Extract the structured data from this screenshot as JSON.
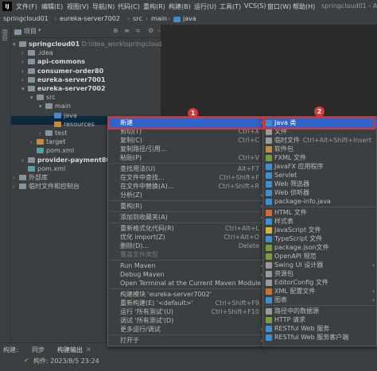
{
  "menubar": {
    "logo": "IJ",
    "items": [
      "文件(F)",
      "编辑(E)",
      "视图(V)",
      "导航(N)",
      "代码(C)",
      "重构(R)",
      "构建(B)",
      "运行(U)",
      "工具(T)",
      "VCS(S)",
      "窗口(W)",
      "帮助(H)"
    ],
    "title": "springcloud01 - Admi"
  },
  "navbar": [
    "springcloud01",
    "eureka-server7002",
    "src",
    "main",
    "java"
  ],
  "stripe": {
    "label": "项目"
  },
  "project_header": {
    "label": "项目"
  },
  "tree": [
    {
      "label": "springcloud01",
      "suffix": " D:\\idea_work\\springcloud01",
      "indent": 0,
      "bold": true,
      "icon": "folder-icon"
    },
    {
      "label": ".idea",
      "indent": 1,
      "icon": "folder-icon"
    },
    {
      "label": "api-commons",
      "indent": 1,
      "bold": true,
      "icon": "folder-icon"
    },
    {
      "label": "consumer-order80",
      "indent": 1,
      "bold": true,
      "icon": "folder-icon"
    },
    {
      "label": "eureka-server7001",
      "indent": 1,
      "bold": true,
      "icon": "folder-icon"
    },
    {
      "label": "eureka-server7002",
      "indent": 1,
      "bold": true,
      "icon": "folder-icon"
    },
    {
      "label": "src",
      "indent": 2,
      "icon": "folder-icon"
    },
    {
      "label": "main",
      "indent": 3,
      "icon": "folder-icon"
    },
    {
      "label": "java",
      "indent": 4,
      "icon": "folder-icon"
    },
    {
      "label": "resources",
      "indent": 4,
      "icon": "folder-icon"
    },
    {
      "label": "test",
      "indent": 3,
      "icon": "folder-icon"
    },
    {
      "label": "target",
      "indent": 2,
      "icon": "folder-icon"
    },
    {
      "label": "pom.xml",
      "indent": 2,
      "icon": "file-icon"
    },
    {
      "label": "provider-payment8001",
      "indent": 1,
      "bold": true,
      "icon": "folder-icon"
    },
    {
      "label": "pom.xml",
      "indent": 1,
      "icon": "file-icon"
    },
    {
      "label": "外部库",
      "indent": 0,
      "icon": "library-icon"
    },
    {
      "label": "临时文件和控制台",
      "indent": 0,
      "icon": "scratch-icon"
    }
  ],
  "bottom": {
    "tabs": [
      "构建:",
      "同步",
      "构建输出"
    ],
    "status": "构件: 2023/8/5 23:24"
  },
  "context_menu": [
    {
      "label": "新建",
      "shortcut": "",
      "submenu": true,
      "highlight": true
    },
    {
      "label": "剪切(T)",
      "shortcut": "Ctrl+X"
    },
    {
      "label": "复制(C)",
      "shortcut": "Ctrl+C"
    },
    {
      "label": "复制路径/引用...",
      "shortcut": ""
    },
    {
      "label": "粘贴(P)",
      "shortcut": "Ctrl+V"
    },
    {
      "sep": true
    },
    {
      "label": "查找用法(U)",
      "shortcut": "Alt+F7"
    },
    {
      "label": "在文件中查找...",
      "shortcut": "Ctrl+Shift+F"
    },
    {
      "label": "在文件中替换(A)...",
      "shortcut": "Ctrl+Shift+R"
    },
    {
      "label": "分析(Z)",
      "shortcut": "",
      "submenu": true
    },
    {
      "sep": true
    },
    {
      "label": "重构(R)",
      "shortcut": "",
      "submenu": true
    },
    {
      "sep": true
    },
    {
      "label": "添加到收藏夹(A)",
      "shortcut": "",
      "submenu": true
    },
    {
      "sep": true
    },
    {
      "label": "重新格式化代码(R)",
      "shortcut": "Ctrl+Alt+L"
    },
    {
      "label": "优化 import(Z)",
      "shortcut": "Ctrl+Alt+O"
    },
    {
      "label": "删除(D)...",
      "shortcut": "Delete"
    },
    {
      "label": "覆盖文件类型",
      "shortcut": "",
      "disabled": true
    },
    {
      "sep": true
    },
    {
      "label": "Run Maven",
      "shortcut": "",
      "submenu": true
    },
    {
      "label": "Debug Maven",
      "shortcut": "",
      "submenu": true
    },
    {
      "label": "Open Terminal at the Current Maven Module Path",
      "shortcut": ""
    },
    {
      "sep": true
    },
    {
      "label": "构建模块 'eureka-server7002'",
      "shortcut": ""
    },
    {
      "label": "重新构建(E) '<default>'",
      "shortcut": "Ctrl+Shift+F9"
    },
    {
      "label": "运行 '所有测试'(U)",
      "shortcut": "Ctrl+Shift+F10"
    },
    {
      "label": "调试 '所有测试'(D)",
      "shortcut": ""
    },
    {
      "label": "更多运行/调试",
      "shortcut": "",
      "submenu": true
    },
    {
      "sep": true
    },
    {
      "label": "打开于",
      "shortcut": "",
      "submenu": true
    }
  ],
  "new_submenu": [
    {
      "label": "Java 类",
      "shortcut": "",
      "highlight": true,
      "icon_color": "#3d8fd1"
    },
    {
      "label": "文件",
      "shortcut": "",
      "icon_color": "#9a9a9a"
    },
    {
      "label": "临时文件",
      "shortcut": "Ctrl+Alt+Shift+Insert",
      "icon_color": "#9a9a9a"
    },
    {
      "label": "软件包",
      "shortcut": "",
      "icon_color": "#c18b42"
    },
    {
      "label": "FXML 文件",
      "shortcut": "",
      "icon_color": "#7a9e3e"
    },
    {
      "label": "JavaFX 应用程序",
      "shortcut": "",
      "icon_color": "#3d8fd1"
    },
    {
      "label": "Servlet",
      "shortcut": "",
      "icon_color": "#3d8fd1"
    },
    {
      "label": "Web 筛选器",
      "shortcut": "",
      "icon_color": "#3d8fd1"
    },
    {
      "label": "Web 侦听器",
      "shortcut": "",
      "icon_color": "#3d8fd1"
    },
    {
      "label": "package-info.java",
      "shortcut": "",
      "icon_color": "#3d8fd1"
    },
    {
      "sep": true
    },
    {
      "label": "HTML 文件",
      "shortcut": "",
      "icon_color": "#d36b35"
    },
    {
      "label": "样式表",
      "shortcut": "",
      "icon_color": "#3d8fd1"
    },
    {
      "label": "JavaScript 文件",
      "shortcut": "",
      "icon_color": "#d6b33d"
    },
    {
      "label": "TypeScript 文件",
      "shortcut": "",
      "icon_color": "#3d8fd1"
    },
    {
      "label": "package.json文件",
      "shortcut": "",
      "icon_color": "#7a9e3e"
    },
    {
      "label": "OpenAPI 规范",
      "shortcut": "",
      "icon_color": "#7a9e3e"
    },
    {
      "label": "Swing UI 设计器",
      "shortcut": "",
      "submenu": true,
      "icon_color": "#9a9a9a"
    },
    {
      "label": "资源包",
      "shortcut": "",
      "icon_color": "#9a9a9a"
    },
    {
      "label": "EditorConfig 文件",
      "shortcut": "",
      "icon_color": "#9a9a9a"
    },
    {
      "label": "XML 配置文件",
      "shortcut": "",
      "submenu": true,
      "icon_color": "#d36b35"
    },
    {
      "label": "图表",
      "shortcut": "",
      "submenu": true,
      "icon_color": "#3d8fd1"
    },
    {
      "sep": true
    },
    {
      "label": "路径中的数据源",
      "shortcut": "",
      "icon_color": "#9a9a9a"
    },
    {
      "label": "HTTP 请求",
      "shortcut": "",
      "icon_color": "#7a9e3e"
    },
    {
      "label": "RESTful Web 服务",
      "shortcut": "",
      "icon_color": "#3d8fd1"
    },
    {
      "label": "RESTful Web 服务客户端",
      "shortcut": "",
      "icon_color": "#3d8fd1"
    }
  ],
  "badges": [
    "1",
    "2"
  ]
}
